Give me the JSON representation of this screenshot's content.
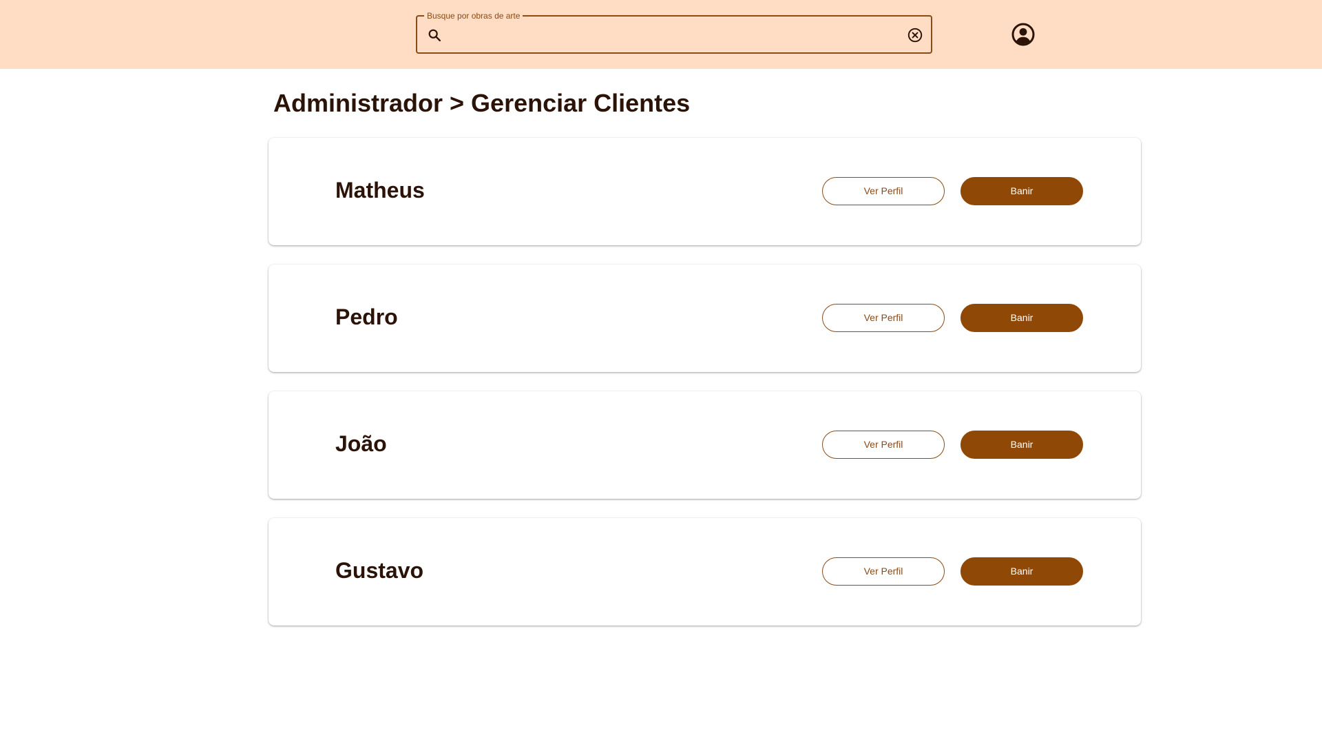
{
  "header": {
    "search": {
      "label": "Busque por obras de arte",
      "value": "",
      "placeholder": ""
    },
    "icons": {
      "search": "search-icon",
      "clear": "cancel-circle-icon",
      "account": "account-circle-icon"
    }
  },
  "main": {
    "title": "Administrador > Gerenciar Clientes",
    "clients": [
      {
        "name": "Matheus",
        "view_label": "Ver Perfil",
        "ban_label": "Banir"
      },
      {
        "name": "Pedro",
        "view_label": "Ver Perfil",
        "ban_label": "Banir"
      },
      {
        "name": "João",
        "view_label": "Ver Perfil",
        "ban_label": "Banir"
      },
      {
        "name": "Gustavo",
        "view_label": "Ver Perfil",
        "ban_label": "Banir"
      }
    ]
  },
  "colors": {
    "topbar": "#ffdcc4",
    "accent": "#8f4806",
    "text": "#2b1308"
  }
}
